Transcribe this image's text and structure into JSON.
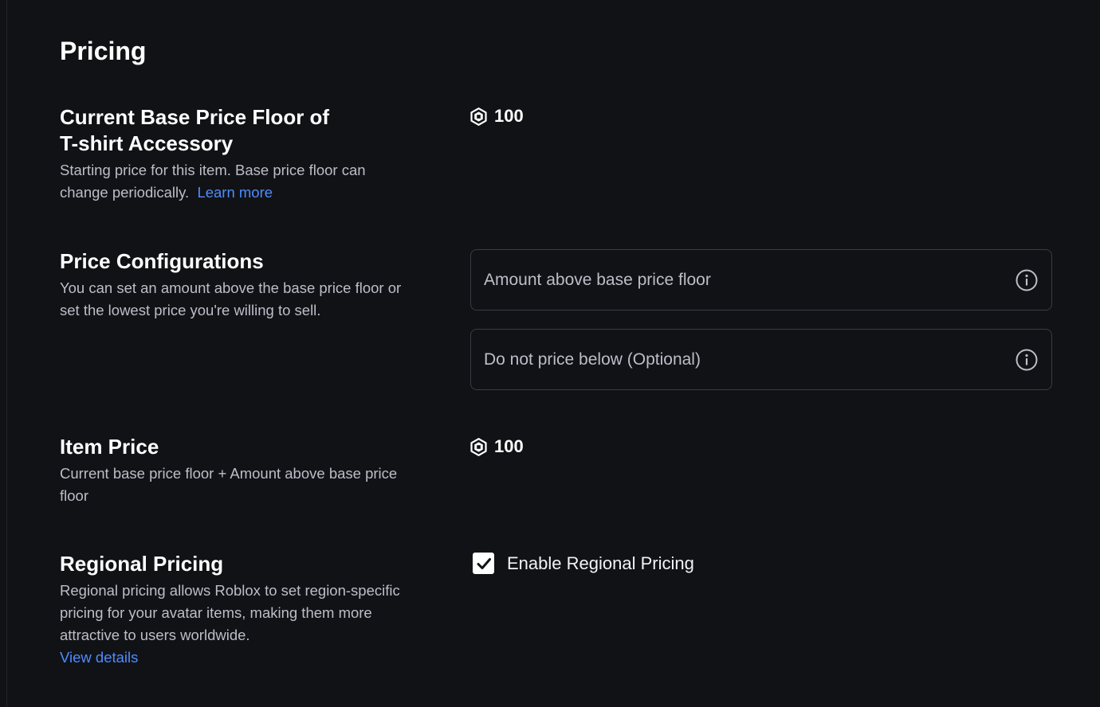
{
  "page": {
    "title": "Pricing"
  },
  "base_price": {
    "title_line1": "Current Base Price Floor of",
    "title_line2": "T-shirt Accessory",
    "description": "Starting price for this item. Base price floor can change periodically.",
    "link": "Learn more",
    "value": "100",
    "currency_icon": "robux-icon"
  },
  "price_config": {
    "title": "Price Configurations",
    "description": "You can set an amount above the base price floor or set the lowest price you're willing to sell.",
    "amount_placeholder": "Amount above base price floor",
    "floor_placeholder": "Do not price below (Optional)",
    "info_icon": "info-icon"
  },
  "item_price": {
    "title": "Item Price",
    "description": "Current base price floor + Amount above base price floor",
    "value": "100",
    "currency_icon": "robux-icon"
  },
  "regional": {
    "title": "Regional Pricing",
    "description": "Regional pricing allows Roblox to set region-specific pricing for your avatar items, making them more attractive to users worldwide.",
    "link": "View details",
    "checkbox_label": "Enable Regional Pricing",
    "checked": true
  },
  "colors": {
    "background": "#111216",
    "text_primary": "#ffffff",
    "text_secondary": "#bcbec8",
    "link": "#4d8cff",
    "field_border": "#3a3c44"
  }
}
